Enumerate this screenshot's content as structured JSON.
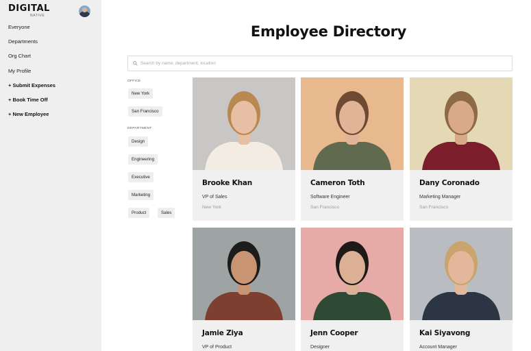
{
  "brand": {
    "main": "DIGITAL",
    "sub": "NATIVE"
  },
  "sidebar": {
    "items": [
      {
        "label": "Everyone"
      },
      {
        "label": "Departments"
      },
      {
        "label": "Org Chart"
      },
      {
        "label": "My Profile"
      },
      {
        "label": "+ Submit Expenses"
      },
      {
        "label": "+ Book Time Off"
      },
      {
        "label": "+ New Employee"
      }
    ]
  },
  "page": {
    "title": "Employee Directory"
  },
  "search": {
    "placeholder": "Search by name, department, location",
    "value": ""
  },
  "filters": {
    "office": {
      "heading": "OFFICE",
      "options": [
        "New York",
        "San Francisco"
      ]
    },
    "department": {
      "heading": "DEPARTMENT",
      "options": [
        "Design",
        "Engineering",
        "Executive",
        "Marketing",
        "Product",
        "Sales"
      ]
    }
  },
  "employees": [
    {
      "name": "Brooke Khan",
      "role": "VP of Sales",
      "office": "New York",
      "photo": {
        "bg": "#c9c7c6",
        "skin": "#e6bfa4",
        "hair": "#b88a52",
        "shirt": "#f3ece2"
      }
    },
    {
      "name": "Cameron Toth",
      "role": "Software Engineer",
      "office": "San Francisco",
      "photo": {
        "bg": "#e8b98e",
        "skin": "#e2b497",
        "hair": "#6e4a33",
        "shirt": "#5f6a4f"
      }
    },
    {
      "name": "Dany Coronado",
      "role": "Marketing Manager",
      "office": "San Francisco",
      "photo": {
        "bg": "#e5d8b4",
        "skin": "#d9a98a",
        "hair": "#8b6a45",
        "shirt": "#7c1d2c"
      }
    },
    {
      "name": "Jamie Ziya",
      "role": "VP of Product",
      "office": "",
      "photo": {
        "bg": "#9ea3a3",
        "skin": "#c89472",
        "hair": "#1c1c1c",
        "shirt": "#7d3f2f"
      }
    },
    {
      "name": "Jenn Cooper",
      "role": "Designer",
      "office": "",
      "photo": {
        "bg": "#e6aaa7",
        "skin": "#dcb094",
        "hair": "#1d1a18",
        "shirt": "#2f4a34"
      }
    },
    {
      "name": "Kai Siyavong",
      "role": "Account Manager",
      "office": "",
      "photo": {
        "bg": "#b9bcc0",
        "skin": "#e2b79c",
        "hair": "#c9a46c",
        "shirt": "#2c3544"
      }
    }
  ]
}
